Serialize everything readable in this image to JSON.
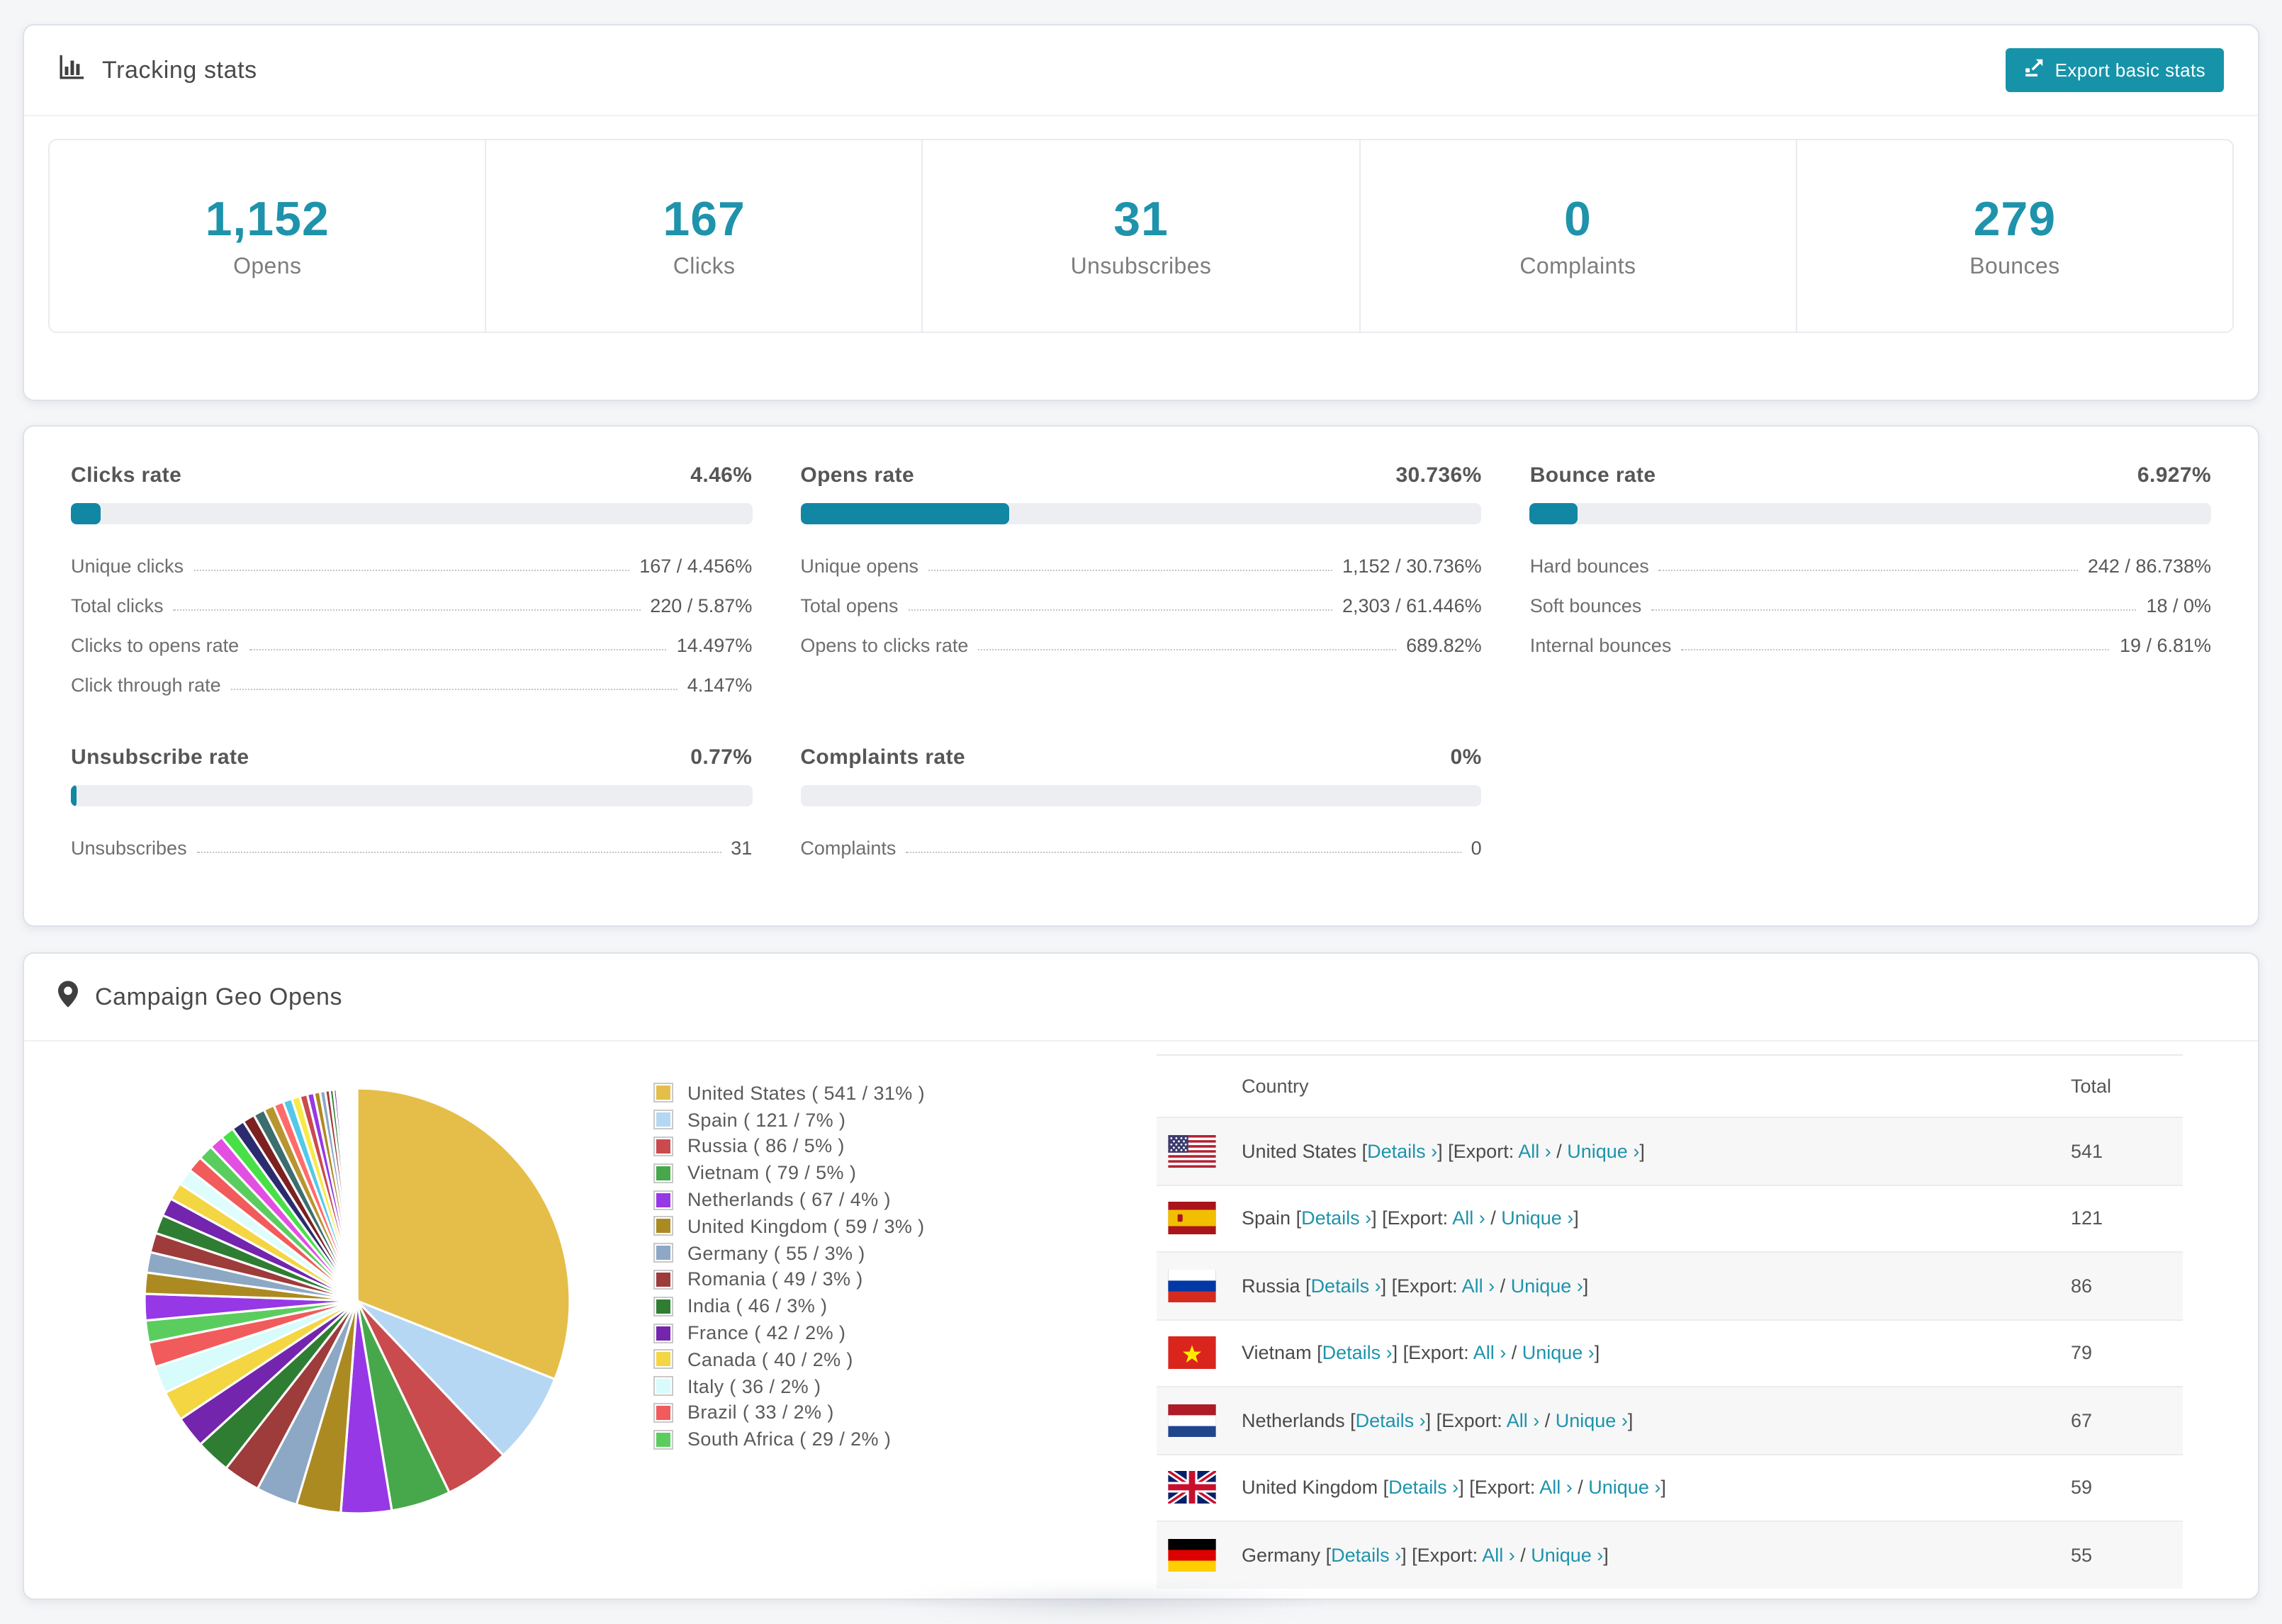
{
  "colors": {
    "accent": "#1E93AB",
    "button": "#1793A9",
    "bar_fill": "#1187A4",
    "bar_track": "#ECEEF2"
  },
  "header": {
    "title": "Tracking stats",
    "export_button": "Export basic stats"
  },
  "summary_stats": [
    {
      "value": "1,152",
      "label": "Opens"
    },
    {
      "value": "167",
      "label": "Clicks"
    },
    {
      "value": "31",
      "label": "Unsubscribes"
    },
    {
      "value": "0",
      "label": "Complaints"
    },
    {
      "value": "279",
      "label": "Bounces"
    }
  ],
  "rates": {
    "clicks": {
      "title": "Clicks rate",
      "value": "4.46%",
      "fill_pct": 4.46,
      "rows": [
        {
          "label": "Unique clicks",
          "value": "167 / 4.456%"
        },
        {
          "label": "Total clicks",
          "value": "220 / 5.87%"
        },
        {
          "label": "Clicks to opens rate",
          "value": "14.497%"
        },
        {
          "label": "Click through rate",
          "value": "4.147%"
        }
      ]
    },
    "opens": {
      "title": "Opens rate",
      "value": "30.736%",
      "fill_pct": 30.736,
      "rows": [
        {
          "label": "Unique opens",
          "value": "1,152 / 30.736%"
        },
        {
          "label": "Total opens",
          "value": "2,303 / 61.446%"
        },
        {
          "label": "Opens to clicks rate",
          "value": "689.82%"
        }
      ]
    },
    "bounce": {
      "title": "Bounce rate",
      "value": "6.927%",
      "fill_pct": 6.927,
      "rows": [
        {
          "label": "Hard bounces",
          "value": "242 / 86.738%"
        },
        {
          "label": "Soft bounces",
          "value": "18 / 0%"
        },
        {
          "label": "Internal bounces",
          "value": "19 / 6.81%"
        }
      ]
    },
    "unsubscribe": {
      "title": "Unsubscribe rate",
      "value": "0.77%",
      "fill_pct": 0.77,
      "rows": [
        {
          "label": "Unsubscribes",
          "value": "31"
        }
      ]
    },
    "complaints": {
      "title": "Complaints rate",
      "value": "0%",
      "fill_pct": 0,
      "rows": [
        {
          "label": "Complaints",
          "value": "0"
        }
      ]
    }
  },
  "geo": {
    "title": "Campaign Geo Opens",
    "table": {
      "headers": {
        "country": "Country",
        "total": "Total"
      },
      "link_labels": {
        "details": "Details ›",
        "export": "Export:",
        "all": "All ›",
        "unique": "Unique ›"
      },
      "punctuation": {
        "open": "[",
        "close": "]",
        "slash": "/"
      },
      "rows": [
        {
          "country": "United States",
          "flag": "us-flag-icon",
          "total": "541"
        },
        {
          "country": "Spain",
          "flag": "es-flag-icon",
          "total": "121"
        },
        {
          "country": "Russia",
          "flag": "ru-flag-icon",
          "total": "86"
        },
        {
          "country": "Vietnam",
          "flag": "vn-flag-icon",
          "total": "79"
        },
        {
          "country": "Netherlands",
          "flag": "nl-flag-icon",
          "total": "67"
        },
        {
          "country": "United Kingdom",
          "flag": "gb-flag-icon",
          "total": "59"
        },
        {
          "country": "Germany",
          "flag": "de-flag-icon",
          "total": "55"
        }
      ]
    }
  },
  "chart_data": {
    "type": "pie",
    "title": "Campaign Geo Opens",
    "legend_position": "right",
    "slices": [
      {
        "name": "United States",
        "value": 541,
        "pct": 31,
        "color": "#E5BE49"
      },
      {
        "name": "Spain",
        "value": 121,
        "pct": 7,
        "color": "#B5D7F4"
      },
      {
        "name": "Russia",
        "value": 86,
        "pct": 5,
        "color": "#C94B4D"
      },
      {
        "name": "Vietnam",
        "value": 79,
        "pct": 5,
        "color": "#47A84B"
      },
      {
        "name": "Netherlands",
        "value": 67,
        "pct": 4,
        "color": "#9638E6"
      },
      {
        "name": "United Kingdom",
        "value": 59,
        "pct": 3,
        "color": "#AC8A22"
      },
      {
        "name": "Germany",
        "value": 55,
        "pct": 3,
        "color": "#8CA8C5"
      },
      {
        "name": "Romania",
        "value": 49,
        "pct": 3,
        "color": "#9E3B3B"
      },
      {
        "name": "India",
        "value": 46,
        "pct": 3,
        "color": "#2E7D33"
      },
      {
        "name": "France",
        "value": 42,
        "pct": 2,
        "color": "#7325AE"
      },
      {
        "name": "Canada",
        "value": 40,
        "pct": 2,
        "color": "#F3D642"
      },
      {
        "name": "Italy",
        "value": 36,
        "pct": 2,
        "color": "#D8FBFB"
      },
      {
        "name": "Brazil",
        "value": 33,
        "pct": 2,
        "color": "#F15B5B"
      },
      {
        "name": "South Africa",
        "value": 29,
        "pct": 2,
        "color": "#5ACD5E"
      }
    ],
    "other_slices_estimated": {
      "values": [
        35,
        28,
        27,
        26,
        25,
        24,
        23,
        22,
        21,
        20,
        19,
        18,
        17,
        16,
        15,
        14,
        13,
        12,
        11,
        10,
        9,
        8,
        7,
        6,
        5,
        4,
        3,
        3,
        2,
        2,
        2,
        2,
        2,
        2,
        2,
        1,
        1,
        1,
        1,
        1,
        1,
        1
      ],
      "palette": [
        "#9638E6",
        "#AC8A22",
        "#8CA8C5",
        "#9E3B3B",
        "#2E7D33",
        "#7325AE",
        "#F3D642",
        "#DFFDFD",
        "#F15B5B",
        "#5ACD5E",
        "#E24FE2",
        "#47E047",
        "#2B2B70",
        "#7C2020",
        "#3C6E6E",
        "#B8952F",
        "#FF6B6B",
        "#55C8E8",
        "#F7EA48",
        "#C94B4D"
      ]
    }
  }
}
